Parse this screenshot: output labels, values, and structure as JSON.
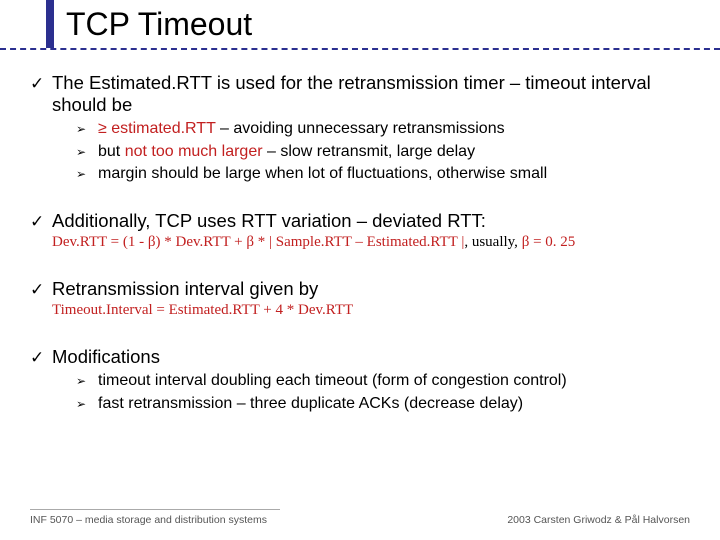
{
  "title": "TCP Timeout",
  "bullets": {
    "b1": "The Estimated.RTT is used for the retransmission timer – timeout interval should be",
    "b1s1_pre": "≥ estimated.RTT",
    "b1s1_rest": " – avoiding unnecessary retransmissions",
    "b1s2_pre": "but ",
    "b1s2_em": "not too much larger",
    "b1s2_rest": " – slow retransmit, large delay",
    "b1s3": "margin should be large when lot of fluctuations, otherwise small",
    "b2": "Additionally, TCP uses RTT variation – deviated RTT:",
    "b2_formula_a": "Dev.RTT = (1 - β) * Dev.RTT + β * | Sample.RTT – Estimated.RTT |",
    "b2_formula_b": ", usually, ",
    "b2_formula_c": "β = 0. 25",
    "b3": "Retransmission interval given by",
    "b3_formula": "Timeout.Interval = Estimated.RTT + 4 * Dev.RTT",
    "b4": "Modifications",
    "b4s1": "timeout interval doubling each timeout (form of congestion control)",
    "b4s2": "fast retransmission – three duplicate ACKs (decrease delay)"
  },
  "glyphs": {
    "check": "✓",
    "arrow": "➢"
  },
  "footer": {
    "left": "INF 5070 – media storage and distribution systems",
    "right": "2003  Carsten Griwodz & Pål Halvorsen"
  }
}
